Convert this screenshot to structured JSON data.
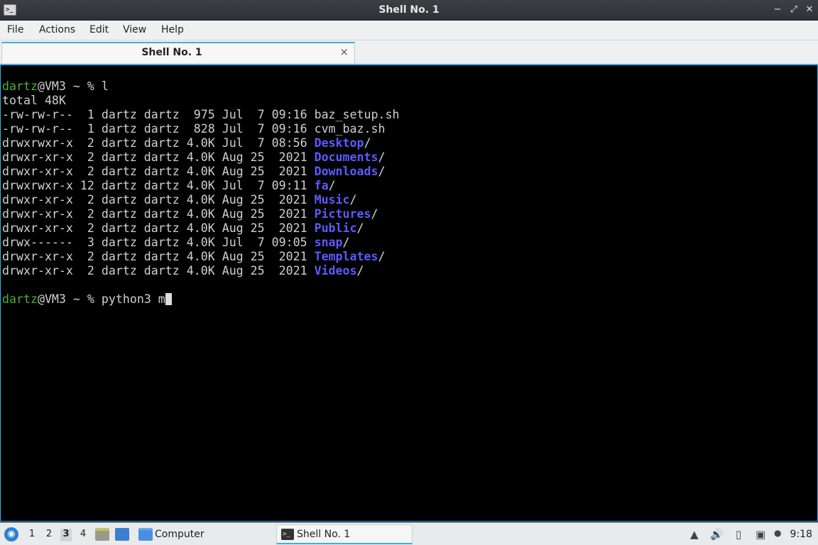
{
  "window": {
    "title": "Shell No. 1",
    "controls": {
      "minimize": "−",
      "maximize": "⤢",
      "close": "✕"
    }
  },
  "menubar": {
    "items": [
      "File",
      "Actions",
      "Edit",
      "View",
      "Help"
    ]
  },
  "tabs": [
    {
      "label": "Shell No. 1",
      "close": "×"
    }
  ],
  "terminal": {
    "prompt_user": "dartz",
    "prompt_host": "@VM3 ~ % ",
    "cmd1": "l",
    "total": "total 48K",
    "rows": [
      {
        "perm": "-rw-rw-r--  1 dartz dartz  975 Jul  7 09:16 ",
        "name": "baz_setup.sh",
        "dir": false
      },
      {
        "perm": "-rw-rw-r--  1 dartz dartz  828 Jul  7 09:16 ",
        "name": "cvm_baz.sh",
        "dir": false
      },
      {
        "perm": "drwxrwxr-x  2 dartz dartz 4.0K Jul  7 08:56 ",
        "name": "Desktop",
        "dir": true
      },
      {
        "perm": "drwxr-xr-x  2 dartz dartz 4.0K Aug 25  2021 ",
        "name": "Documents",
        "dir": true
      },
      {
        "perm": "drwxr-xr-x  2 dartz dartz 4.0K Aug 25  2021 ",
        "name": "Downloads",
        "dir": true
      },
      {
        "perm": "drwxrwxr-x 12 dartz dartz 4.0K Jul  7 09:11 ",
        "name": "fa",
        "dir": true
      },
      {
        "perm": "drwxr-xr-x  2 dartz dartz 4.0K Aug 25  2021 ",
        "name": "Music",
        "dir": true
      },
      {
        "perm": "drwxr-xr-x  2 dartz dartz 4.0K Aug 25  2021 ",
        "name": "Pictures",
        "dir": true
      },
      {
        "perm": "drwxr-xr-x  2 dartz dartz 4.0K Aug 25  2021 ",
        "name": "Public",
        "dir": true
      },
      {
        "perm": "drwx------  3 dartz dartz 4.0K Jul  7 09:05 ",
        "name": "snap",
        "dir": true
      },
      {
        "perm": "drwxr-xr-x  2 dartz dartz 4.0K Aug 25  2021 ",
        "name": "Templates",
        "dir": true
      },
      {
        "perm": "drwxr-xr-x  2 dartz dartz 4.0K Aug 25  2021 ",
        "name": "Videos",
        "dir": true
      }
    ],
    "cmd2": "python3 m",
    "dir_suffix": "/"
  },
  "taskbar": {
    "start_icon": "start-menu-icon",
    "desktops": [
      "1",
      "2",
      "3",
      "4"
    ],
    "active_desktop": "3",
    "computer_label": "Computer",
    "active_task": "Shell No. 1",
    "clock": "9:18"
  },
  "colors": {
    "prompt_green": "#4fae3c",
    "dir_blue": "#5b5bff",
    "accent": "#3daee9"
  }
}
